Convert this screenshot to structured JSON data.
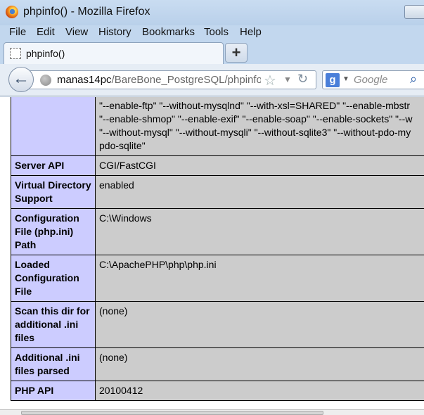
{
  "window": {
    "title": "phpinfo() - Mozilla Firefox"
  },
  "menu": [
    "File",
    "Edit",
    "View",
    "History",
    "Bookmarks",
    "Tools",
    "Help"
  ],
  "tab": {
    "label": "phpinfo()",
    "new_tab": "+"
  },
  "nav": {
    "url_host": "manas14pc",
    "url_path": "/BareBone_PostgreSQL/phpinfo.p",
    "search_engine": "g",
    "search_placeholder": "Google"
  },
  "configure_lines": [
    "\"--enable-ftp\" \"--without-mysqlnd\" \"--with-xsl=SHARED\" \"--enable-mbstr",
    "\"--enable-shmop\" \"--enable-exif\" \"--enable-soap\" \"--enable-sockets\" \"--w",
    "\"--without-mysql\" \"--without-mysqli\" \"--without-sqlite3\" \"--without-pdo-my",
    "pdo-sqlite\""
  ],
  "rows": [
    {
      "key": "Server API",
      "value": "CGI/FastCGI"
    },
    {
      "key": "Virtual Directory Support",
      "value": "enabled"
    },
    {
      "key": "Configuration File (php.ini) Path",
      "value": "C:\\Windows"
    },
    {
      "key": "Loaded Configuration File",
      "value": "C:\\ApachePHP\\php\\php.ini"
    },
    {
      "key": "Scan this dir for additional .ini files",
      "value": "(none)"
    },
    {
      "key": "Additional .ini files parsed",
      "value": "(none)"
    },
    {
      "key": "PHP API",
      "value": "20100412"
    }
  ]
}
